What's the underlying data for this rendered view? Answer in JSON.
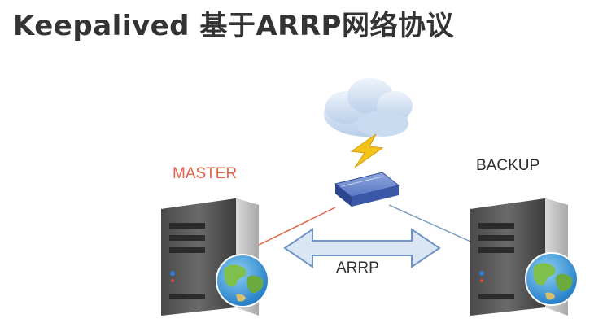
{
  "title": "Keepalived 基于ARRP网络协议",
  "nodes": {
    "master": {
      "label": "MASTER"
    },
    "backup": {
      "label": "BACKUP"
    }
  },
  "link": {
    "label": "ARRP"
  },
  "colors": {
    "master_label": "#e8614a",
    "master_link": "#e8614a",
    "backup_link": "#7a9cc6",
    "arrow_fill": "#dbe6f4",
    "arrow_stroke": "#6f93c4",
    "switch": "#3b57a8",
    "lightning": "#f2c318",
    "cloud": "#c7d9ef"
  },
  "icons": [
    "cloud-icon",
    "lightning-icon",
    "network-switch-icon",
    "server-icon",
    "globe-icon",
    "double-arrow-icon"
  ]
}
